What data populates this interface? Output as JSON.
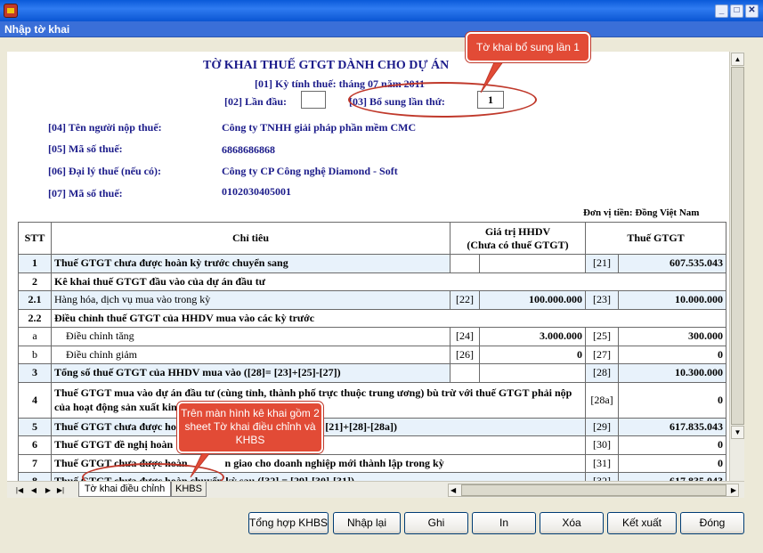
{
  "window": {
    "inner_title": "Nhập tờ khai"
  },
  "form": {
    "title": "TỜ KHAI THUẾ GTGT DÀNH CHO DỰ ÁN",
    "period": "[01] Kỳ tính thuế: tháng 07 năm 2011",
    "first_label": "[02] Lần đầu:",
    "supp_label": "[03] Bổ sung lần thứ:",
    "supp_value": "1",
    "rows": [
      {
        "label": "[04] Tên người nộp thuế:",
        "value": "Công ty TNHH giải pháp phần mềm CMC"
      },
      {
        "label": "[05] Mã số thuế:",
        "value": "6868686868"
      },
      {
        "label": "[06] Đại lý thuế (nếu có):",
        "value": "Công ty CP Công nghệ Diamond - Soft"
      },
      {
        "label": "[07] Mã số thuế:",
        "value": "0102030405001"
      }
    ],
    "currency": "Đơn vị tiền: Đồng Việt Nam"
  },
  "table": {
    "h_stt": "STT",
    "h_chitieu": "Chỉ tiêu",
    "h_gtri1": "Giá trị HHDV",
    "h_gtri2": "(Chưa có thuế GTGT)",
    "h_thue": "Thuế GTGT",
    "r1": {
      "stt": "1",
      "label": "Thuế GTGT chưa được hoàn kỳ trước chuyển sang",
      "c2": "[21]",
      "v2": "607.535.043"
    },
    "r2": {
      "stt": "2",
      "label": "Kê khai thuế GTGT đầu vào của dự án đầu tư"
    },
    "r21": {
      "stt": "2.1",
      "label": "Hàng hóa, dịch vụ mua vào trong kỳ",
      "c1": "[22]",
      "v1": "100.000.000",
      "c2": "[23]",
      "v2": "10.000.000"
    },
    "r22": {
      "stt": "2.2",
      "label": "Điều chỉnh thuế GTGT của HHDV mua vào các kỳ trước"
    },
    "ra": {
      "stt": "a",
      "label": "Điều chỉnh tăng",
      "c1": "[24]",
      "v1": "3.000.000",
      "c2": "[25]",
      "v2": "300.000"
    },
    "rb": {
      "stt": "b",
      "label": "Điều chỉnh giảm",
      "c1": "[26]",
      "v1": "0",
      "c2": "[27]",
      "v2": "0"
    },
    "r3": {
      "stt": "3",
      "label": "Tổng số thuế GTGT của HHDV mua vào ([28]= [23]+[25]-[27])",
      "c2": "[28]",
      "v2": "10.300.000"
    },
    "r4": {
      "stt": "4",
      "label1": "Thuế GTGT mua vào dự án đầu tư (cùng tỉnh, thành phố trực thuộc trung ương) bù trừ với thuế GTGT phải nộp",
      "label2": "của hoạt động sản xuất kinh",
      "c2": "[28a]",
      "v2": "0"
    },
    "r5": {
      "stt": "5",
      "label": "Thuế GTGT chưa được hoàn",
      "label_tail": "u tư ([29] = [21]+[28]-[28a])",
      "c2": "[29]",
      "v2": "617.835.043"
    },
    "r6": {
      "stt": "6",
      "label": "Thuế GTGT đề nghị hoàn",
      "c2": "[30]",
      "v2": "0"
    },
    "r7": {
      "stt": "7",
      "label": "Thuế GTGT chưa được hoàn",
      "label_tail": "n giao cho doanh nghiệp mới thành lập trong kỳ",
      "c2": "[31]",
      "v2": "0"
    },
    "r8": {
      "stt": "8",
      "label": "Thuế GTGT chưa được hoàn chuyển kỳ sau ([32] = [29]-[30]-[31])",
      "c2": "[32]",
      "v2": "617.835.043"
    }
  },
  "callouts": {
    "top": "Tờ khai bổ sung lần 1",
    "bottom": "Trên màn hình kê khai gồm 2 sheet Tờ khai điều chỉnh và KHBS"
  },
  "tabs": [
    "Tờ khai điều chỉnh",
    "KHBS"
  ],
  "buttons": {
    "tonghop": "Tổng hợp KHBS",
    "nhaplai": "Nhập lại",
    "ghi": "Ghi",
    "in": "In",
    "xoa": "Xóa",
    "ketxuat": "Kết xuất",
    "dong": "Đóng"
  },
  "colors": {
    "titlebar": "#0a5ad9",
    "callout": "#e24b36",
    "row_highlight": "#e8f2fb",
    "form_text": "#1b1b8a"
  }
}
